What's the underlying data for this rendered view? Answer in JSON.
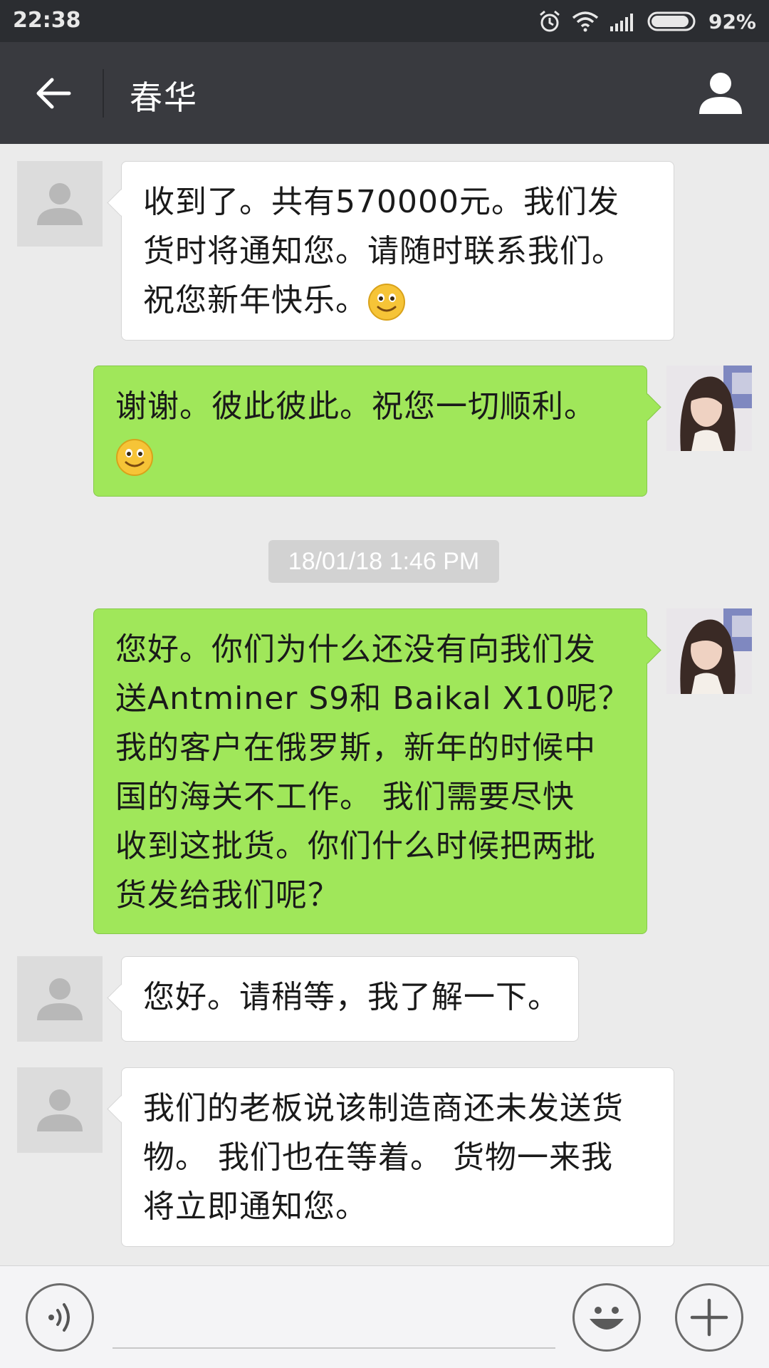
{
  "status_bar": {
    "time": "22:38",
    "battery_percent": "92%",
    "battery_level": 0.92,
    "icons": [
      "alarm-icon",
      "wifi-icon",
      "signal-icon",
      "battery-icon"
    ]
  },
  "header": {
    "title": "春华",
    "back_icon": "arrow-left-icon",
    "profile_icon": "person-icon"
  },
  "messages": [
    {
      "sender": "contact",
      "lines": [
        "收到了。共有570000元。我们发",
        "货时将通知您。请随时联系我们。",
        "祝您新年快乐。"
      ],
      "emoji": "smile-emoji"
    },
    {
      "sender": "me",
      "lines": [
        "谢谢。彼此彼此。祝您一切顺利。"
      ],
      "emoji": "smile-emoji"
    },
    {
      "sender": "me",
      "lines": [
        "您好。你们为什么还没有向我们发",
        "送Antminer S9和 Baikal X10呢？",
        "我的客户在俄罗斯，新年的时候中",
        "国的海关不工作。 我们需要尽快",
        "收到这批货。你们什么时候把两批",
        "货发给我们呢？"
      ]
    },
    {
      "sender": "contact",
      "lines": [
        "您好。请稍等，我了解一下。"
      ]
    },
    {
      "sender": "contact",
      "lines": [
        "我们的老板说该制造商还未发送货",
        "物。 我们也在等着。 货物一来我",
        "将立即通知您。"
      ]
    }
  ],
  "timestamp": "18/01/18 1:46 PM",
  "input_bar": {
    "voice_icon": "voice-icon",
    "text_value": "",
    "emoji_icon": "emoji-icon",
    "plus_icon": "plus-icon"
  },
  "colors": {
    "status_bar_bg": "#2b2d31",
    "header_bg": "#393a3f",
    "chat_bg": "#ebebeb",
    "outgoing_bubble": "#a0e75a",
    "incoming_bubble": "#ffffff",
    "timestamp_bg": "#d2d2d2"
  }
}
